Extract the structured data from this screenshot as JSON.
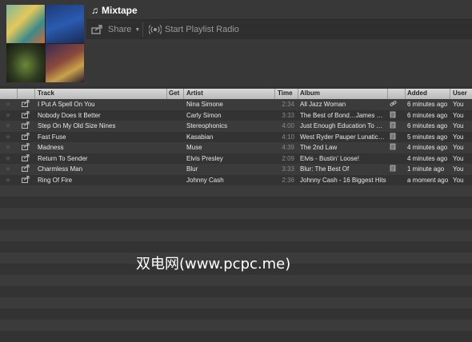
{
  "playlist": {
    "title": "Mixtape"
  },
  "toolbar": {
    "share_label": "Share",
    "radio_label": "Start Playlist Radio"
  },
  "columns": [
    "Track",
    "Get",
    "Artist",
    "Time",
    "Album",
    "Added",
    "User"
  ],
  "rows": [
    {
      "track": "I Put A Spell On You",
      "get": true,
      "artist": "Nina Simone",
      "time": "2:34",
      "album": "All Jazz Woman",
      "album_icon": "link-icon",
      "added": "6 minutes ago",
      "user": "You"
    },
    {
      "track": "Nobody Does It Better",
      "get": true,
      "artist": "Carly Simon",
      "time": "3:33",
      "album": "The Best of Bond…James …",
      "album_icon": "file-icon",
      "added": "6 minutes ago",
      "user": "You"
    },
    {
      "track": "Step On My Old Size Nines",
      "get": false,
      "artist": "Stereophonics",
      "time": "4:00",
      "album": "Just Enough Education To …",
      "album_icon": "file-icon",
      "added": "6 minutes ago",
      "user": "You"
    },
    {
      "track": "Fast Fuse",
      "get": false,
      "artist": "Kasabian",
      "time": "4:10",
      "album": "West Ryder Pauper Lunatic…",
      "album_icon": "file-icon",
      "added": "5 minutes ago",
      "user": "You"
    },
    {
      "track": "Madness",
      "get": false,
      "artist": "Muse",
      "time": "4:39",
      "album": "The 2nd Law",
      "album_icon": "file-icon",
      "added": "4 minutes ago",
      "user": "You"
    },
    {
      "track": "Return To Sender",
      "get": true,
      "artist": "Elvis Presley",
      "time": "2:09",
      "album": "Elvis - Bustin' Loose!",
      "album_icon": "",
      "added": "4 minutes ago",
      "user": "You"
    },
    {
      "track": "Charmless Man",
      "get": false,
      "artist": "Blur",
      "time": "3:33",
      "album": "Blur: The Best Of",
      "album_icon": "file-icon",
      "added": "1 minute ago",
      "user": "You"
    },
    {
      "track": "Ring Of Fire",
      "get": true,
      "artist": "Johnny Cash",
      "time": "2:36",
      "album": "Johnny Cash - 16 Biggest Hits",
      "album_icon": "",
      "added": "a moment ago",
      "user": "You"
    }
  ],
  "watermark": "双电网(www.pcpc.me)"
}
